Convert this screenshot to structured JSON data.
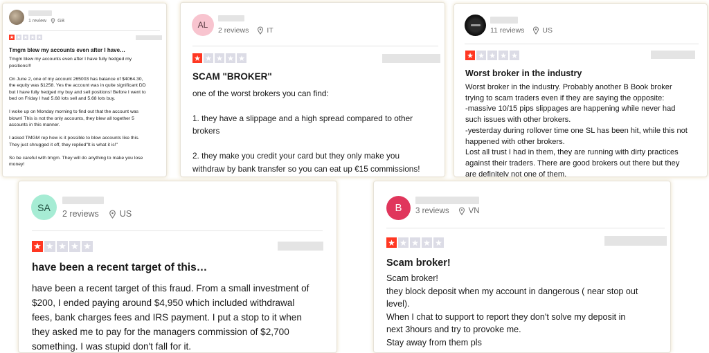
{
  "reviews": [
    {
      "avatar_text": "",
      "reviews_count": "1 review",
      "country": "GB",
      "rating": 1,
      "title": "Tmgm blew my accounts even after I have…",
      "body": "Tmgm blew my accounts even after I have fully hedged my\npositions!!!\n\nOn June 2, one of my account 265003 has balance of $4064.30,\nthe equity was $1258. Yes the account was in quite significant DD\nbut I have fully hedged my buy and sell positions! Before I went to\nbed on Friday I had 5.68 lots sell and 5.68 lots buy.\n\nI woke up on Monday morning to find out that the account was\nblown! This is not the only accounts, they blew all together 5\naccounts in this manner.\n\nI asked TMGM rep how is it possible to blow accounts like this.\nThey just shrugged it off, they replied\"It is what it is!\"\n\nSo be careful with tmgm. They will do anything to make you lose\nmoney!"
    },
    {
      "avatar_text": "AL",
      "reviews_count": "2 reviews",
      "country": "IT",
      "rating": 1,
      "title": "SCAM \"BROKER\"",
      "body": "one of the worst brokers you can find:\n\n1. they have a slippage and a high spread compared to other\nbrokers\n\n2. they make you credit your card but they only make you\nwithdraw by bank transfer so you can eat up €15 commissions!\nthis broker is a scam!"
    },
    {
      "avatar_text": "",
      "reviews_count": "11 reviews",
      "country": "US",
      "rating": 1,
      "title": "Worst broker in the industry",
      "body": "Worst broker in the industry. Probably another B Book broker\ntrying to scam traders even if they are saying the opposite:\n-massive 10/15 pips slippages are happening while never had\nsuch issues with other brokers.\n-yesterday during rollover time one SL has been hit, while this not\nhappened with other brokers.\nLost all trust I had in them, they are running with dirty practices\nagainst their traders. There are good brokers out there but they\nare definitely not one of them."
    },
    {
      "avatar_text": "SA",
      "reviews_count": "2 reviews",
      "country": "US",
      "rating": 1,
      "title": "have been a recent target of this…",
      "body": "have been a recent target of this fraud. From a small investment of\n$200, I ended paying around $4,950 which included withdrawal\nfees, bank charges fees and IRS payment. I put a stop to it when\nthey asked me to pay for the managers commission of $2,700\nsomething. I was stupid don't fall for it."
    },
    {
      "avatar_text": "B",
      "reviews_count": "3 reviews",
      "country": "VN",
      "rating": 1,
      "title": "Scam broker!",
      "body": "Scam broker!\nthey block deposit when my account in dangerous ( near stop out\nlevel).\nWhen I chat to support to report they don't solve my deposit in\nnext 3hours and try to provoke me.\nStay away from them pls"
    }
  ],
  "colors": {
    "star_on": "#ff3722",
    "star_off": "#dcdce6",
    "avatar_AL": "#f8c4cf",
    "avatar_SA": "#a6ecd4",
    "avatar_B": "#e0365c"
  },
  "icons": {
    "location": "location-pin-icon",
    "star": "star-icon"
  }
}
